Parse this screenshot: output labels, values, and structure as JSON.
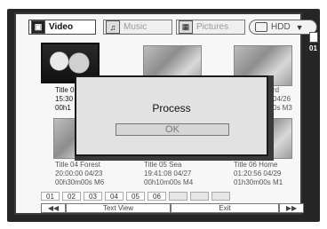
{
  "tabs": [
    {
      "label": "Video",
      "icon": "film-icon",
      "active": true
    },
    {
      "label": "Music",
      "icon": "music-note-icon",
      "active": false
    },
    {
      "label": "Pictures",
      "icon": "picture-icon",
      "active": false
    }
  ],
  "source": {
    "label": "HDD",
    "icon": "disk-icon",
    "arrow": "▼"
  },
  "page_indicator": {
    "number": "01"
  },
  "thumbnails": [
    {
      "lines": [
        "Title 0",
        "15:30",
        "00h1"
      ],
      "selected": true
    },
    {
      "lines": [
        "",
        "",
        ""
      ],
      "selected": false
    },
    {
      "lines": [
        "rd",
        "04/26",
        "0s M3"
      ],
      "selected": false
    },
    {
      "lines": [
        "Title 04 Forest",
        "20:00:00 04/23",
        "00h30m00s M6"
      ],
      "selected": false
    },
    {
      "lines": [
        "Title 05 Sea",
        "19:41:08 04/27",
        "00h10m00s M4"
      ],
      "selected": false
    },
    {
      "lines": [
        "Title 06 Home",
        "01:20:56 04/29",
        "01h30m00s M1"
      ],
      "selected": false
    }
  ],
  "dialog": {
    "title": "Process",
    "ok_label": "OK"
  },
  "pages": [
    "01",
    "02",
    "03",
    "04",
    "05",
    "06",
    "",
    "",
    ""
  ],
  "bottom": {
    "prev_icon": "◀◀",
    "text_view": "Text View",
    "exit": "Exit",
    "next_icon": "▶▶"
  }
}
